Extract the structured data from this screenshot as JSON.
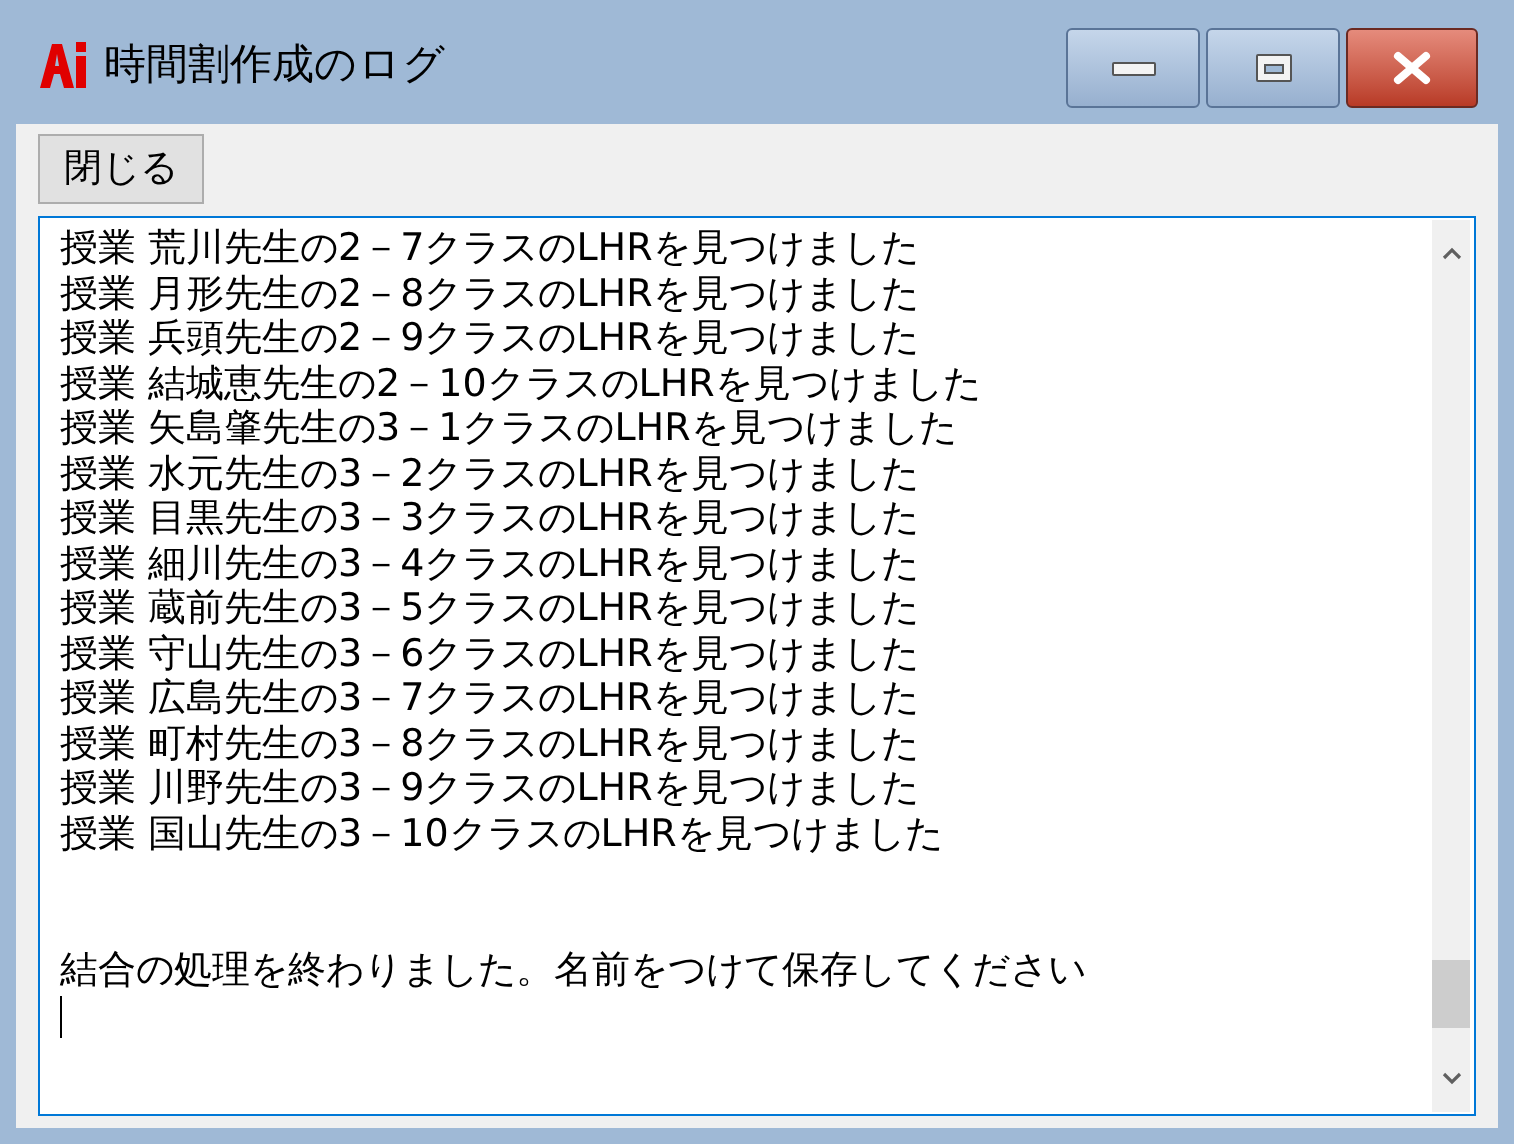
{
  "window": {
    "title": "時間割作成のログ"
  },
  "toolbar": {
    "close_button": "閉じる"
  },
  "log": {
    "lines": [
      "授業 荒川先生の2－7クラスのLHRを見つけました",
      "授業 月形先生の2－8クラスのLHRを見つけました",
      "授業 兵頭先生の2－9クラスのLHRを見つけました",
      "授業 結城恵先生の2－10クラスのLHRを見つけました",
      "授業 矢島肇先生の3－1クラスのLHRを見つけました",
      "授業 水元先生の3－2クラスのLHRを見つけました",
      "授業 目黒先生の3－3クラスのLHRを見つけました",
      "授業 細川先生の3－4クラスのLHRを見つけました",
      "授業 蔵前先生の3－5クラスのLHRを見つけました",
      "授業 守山先生の3－6クラスのLHRを見つけました",
      "授業 広島先生の3－7クラスのLHRを見つけました",
      "授業 町村先生の3－8クラスのLHRを見つけました",
      "授業 川野先生の3－9クラスのLHRを見つけました",
      "授業 国山先生の3－10クラスのLHRを見つけました"
    ],
    "message": "結合の処理を終わりました。名前をつけて保存してください"
  }
}
